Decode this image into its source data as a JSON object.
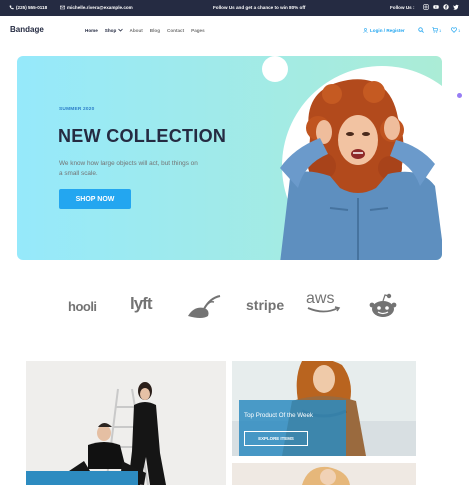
{
  "topbar": {
    "phone": "(225) 555-0118",
    "email": "michelle.rivera@example.com",
    "promo": "Follow Us  and get a chance to win 80% off",
    "follow": "Follow Us :"
  },
  "nav": {
    "brand": "Bandage",
    "menu": [
      "Home",
      "Shop",
      "About",
      "Blog",
      "Contact",
      "Pages"
    ],
    "login": "Login / Register",
    "cart_count": "1",
    "wish_count": "1"
  },
  "hero": {
    "overline": "SUMMER 2020",
    "title": "NEW COLLECTION",
    "subtitle": "We know how large objects will act, but things on a small scale.",
    "cta": "SHOP NOW"
  },
  "logos": [
    "hooli",
    "lyft",
    "",
    "stripe",
    "aws",
    ""
  ],
  "products": {
    "tile_title": "Top Product Of the Week",
    "tile_button": "EXPLORE ITEMS"
  },
  "colors": {
    "dark": "#252b42",
    "primary": "#23a6f0",
    "muted": "#737373"
  }
}
